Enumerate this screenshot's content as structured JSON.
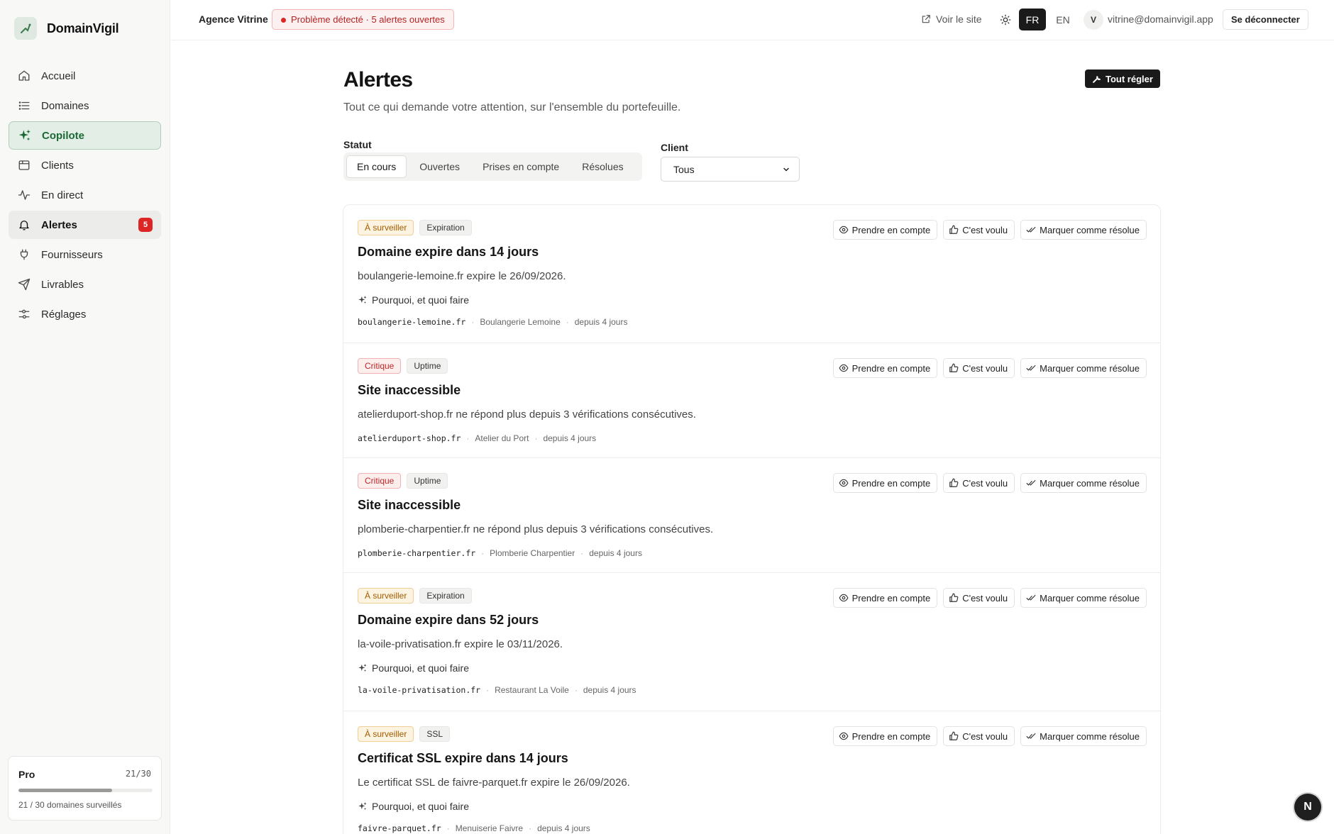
{
  "brand": {
    "name": "DomainVigil"
  },
  "sidebar": {
    "items": [
      {
        "label": "Accueil",
        "icon": "home-icon"
      },
      {
        "label": "Domaines",
        "icon": "list-icon"
      },
      {
        "label": "Copilote",
        "icon": "sparkles-icon"
      },
      {
        "label": "Clients",
        "icon": "folder-icon"
      },
      {
        "label": "En direct",
        "icon": "activity-icon"
      },
      {
        "label": "Alertes",
        "icon": "bell-icon",
        "badge": "5"
      },
      {
        "label": "Fournisseurs",
        "icon": "plug-icon"
      },
      {
        "label": "Livrables",
        "icon": "send-icon"
      },
      {
        "label": "Réglages",
        "icon": "sliders-icon"
      }
    ]
  },
  "plan": {
    "name": "Pro",
    "count": "21/30",
    "note": "21 / 30 domaines surveillés",
    "usage_fraction": 0.7
  },
  "topbar": {
    "agency": "Agence Vitrine",
    "problem": "Problème détecté · 5 alertes ouvertes",
    "view_site": "Voir le site",
    "lang_fr": "FR",
    "lang_en": "EN",
    "avatar": "V",
    "email": "vitrine@domainvigil.app",
    "logout": "Se déconnecter"
  },
  "page": {
    "title": "Alertes",
    "subtitle": "Tout ce qui demande votre attention, sur l'ensemble du portefeuille.",
    "settle_all": "Tout régler"
  },
  "filters": {
    "status_label": "Statut",
    "tabs": [
      "En cours",
      "Ouvertes",
      "Prises en compte",
      "Résolues"
    ],
    "client_label": "Client",
    "client_value": "Tous"
  },
  "actions": {
    "acknowledge": "Prendre en compte",
    "intended": "C'est voulu",
    "resolve": "Marquer comme résolue",
    "why": "Pourquoi, et quoi faire"
  },
  "alerts": [
    {
      "severity": "À surveiller",
      "category": "Expiration",
      "title": "Domaine expire dans 14 jours",
      "desc": "boulangerie-lemoine.fr expire le 26/09/2026.",
      "why": true,
      "domain": "boulangerie-lemoine.fr",
      "client": "Boulangerie Lemoine",
      "since": "depuis 4 jours"
    },
    {
      "severity": "Critique",
      "category": "Uptime",
      "title": "Site inaccessible",
      "desc": "atelierduport-shop.fr ne répond plus depuis 3 vérifications consécutives.",
      "why": false,
      "domain": "atelierduport-shop.fr",
      "client": "Atelier du Port",
      "since": "depuis 4 jours"
    },
    {
      "severity": "Critique",
      "category": "Uptime",
      "title": "Site inaccessible",
      "desc": "plomberie-charpentier.fr ne répond plus depuis 3 vérifications consécutives.",
      "why": false,
      "domain": "plomberie-charpentier.fr",
      "client": "Plomberie Charpentier",
      "since": "depuis 4 jours"
    },
    {
      "severity": "À surveiller",
      "category": "Expiration",
      "title": "Domaine expire dans 52 jours",
      "desc": "la-voile-privatisation.fr expire le 03/11/2026.",
      "why": true,
      "domain": "la-voile-privatisation.fr",
      "client": "Restaurant La Voile",
      "since": "depuis 4 jours"
    },
    {
      "severity": "À surveiller",
      "category": "SSL",
      "title": "Certificat SSL expire dans 14 jours",
      "desc": "Le certificat SSL de faivre-parquet.fr expire le 26/09/2026.",
      "why": true,
      "domain": "faivre-parquet.fr",
      "client": "Menuiserie Faivre",
      "since": "depuis 4 jours"
    }
  ],
  "fab": {
    "label": "N"
  }
}
